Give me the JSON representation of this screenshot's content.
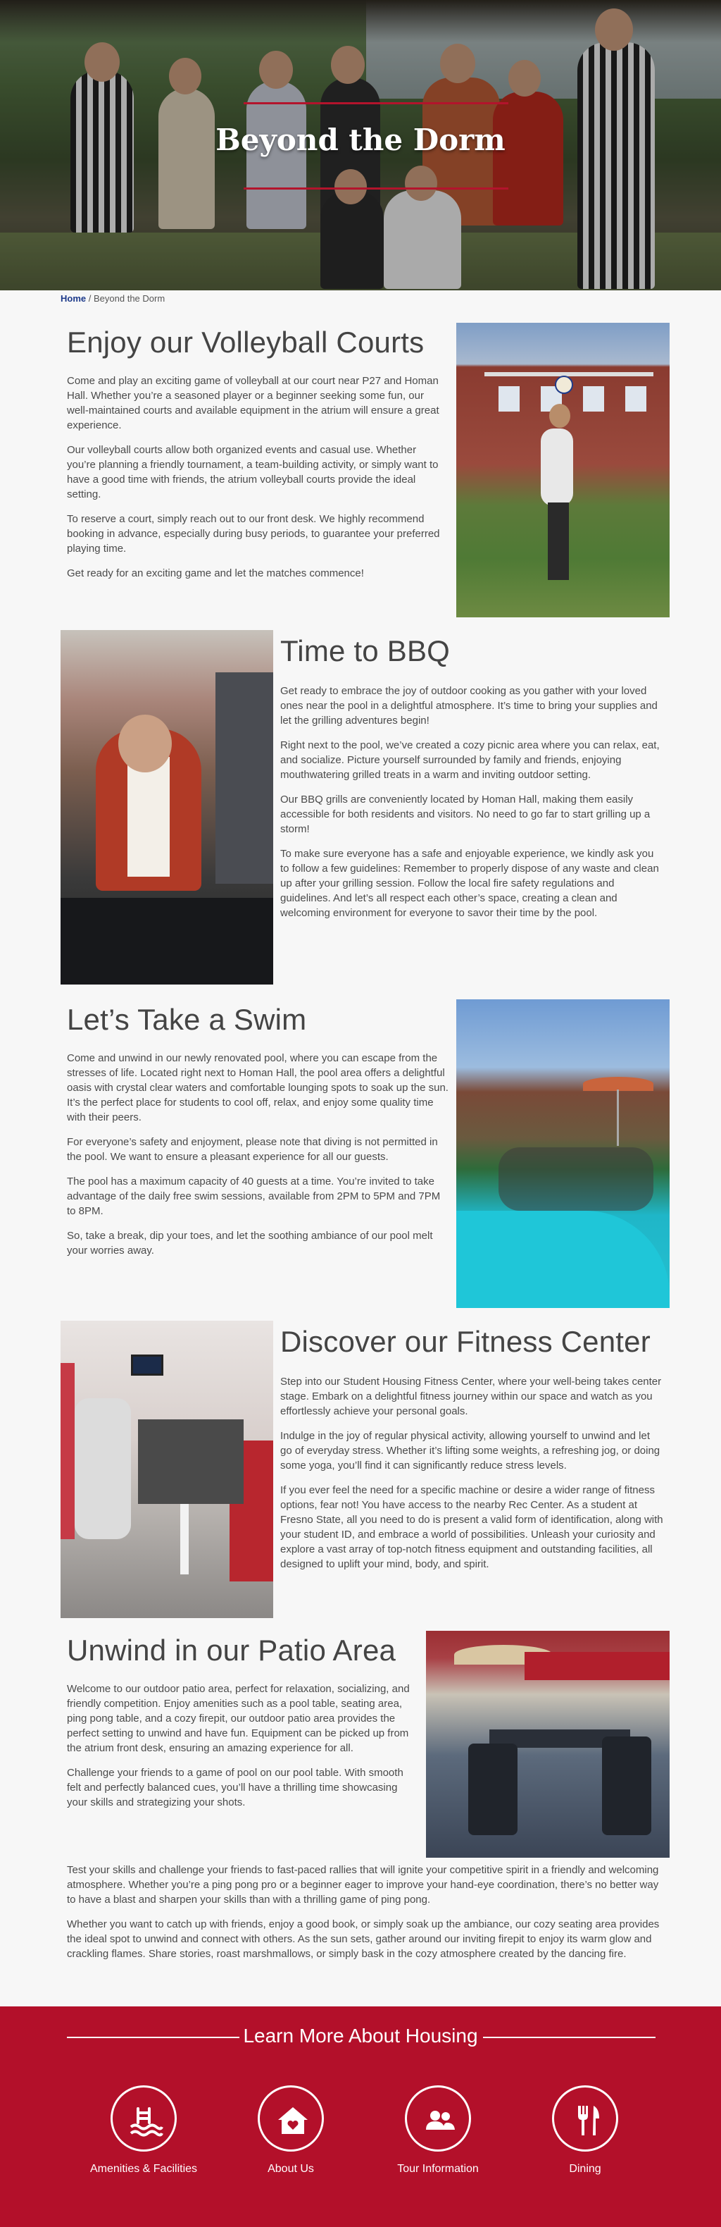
{
  "hero": {
    "title": "Beyond the Dorm"
  },
  "breadcrumb": {
    "home": "Home",
    "separator": "/",
    "current": "Beyond the Dorm"
  },
  "sections": {
    "volleyball": {
      "title": "Enjoy our Volleyball Courts",
      "paragraphs": [
        "Come and play an exciting game of volleyball at our court near P27 and Homan Hall. Whether you’re a seasoned player or a beginner seeking some fun, our well-maintained courts and available equipment in the atrium will ensure a great experience.",
        "Our volleyball courts allow both organized events and casual use. Whether you’re planning a friendly tournament, a team-building activity, or simply want to have a good time with friends, the atrium volleyball courts provide the ideal setting.",
        "To reserve a court, simply reach out to our front desk. We highly recommend booking in advance, especially during busy periods, to guarantee your preferred playing time.",
        "Get ready for an exciting game and let the matches commence!"
      ]
    },
    "bbq": {
      "title": "Time to BBQ",
      "paragraphs": [
        "Get ready to embrace the joy of outdoor cooking as you gather with your loved ones near the pool in a delightful atmosphere. It’s time to bring your supplies and let the grilling adventures begin!",
        "Right next to the pool, we’ve created a cozy picnic area where you can relax, eat, and socialize. Picture yourself surrounded by family and friends, enjoying mouthwatering grilled treats in a warm and inviting outdoor setting.",
        "Our BBQ grills are conveniently located by Homan Hall, making them easily accessible for both residents and visitors. No need to go far to start grilling up a storm!",
        "To make sure everyone has a safe and enjoyable experience, we kindly ask you to follow a few guidelines: Remember to properly dispose of any waste and clean up after your grilling session. Follow the local fire safety regulations and guidelines. And let’s all respect each other’s space, creating a clean and welcoming environment for everyone to savor their time by the pool."
      ]
    },
    "swim": {
      "title": "Let’s Take a Swim",
      "paragraphs": [
        "Come and unwind in our newly renovated pool, where you can escape from the stresses of life. Located right next to Homan Hall, the pool area offers a delightful oasis with crystal clear waters and comfortable lounging spots to soak up the sun. It’s the perfect place for students to cool off, relax, and enjoy some quality time with their peers.",
        "For everyone’s safety and enjoyment, please note that diving is not permitted in the pool. We want to ensure a pleasant experience for all our guests.",
        "The pool has a maximum capacity of 40 guests at a time. You’re invited to take advantage of the daily free swim sessions, available from 2PM to 5PM and 7PM to 8PM.",
        "So, take a break, dip your toes, and let the soothing ambiance of our pool melt your worries away."
      ]
    },
    "fitness": {
      "title": "Discover our Fitness Center",
      "paragraphs": [
        "Step into our Student Housing Fitness Center, where your well-being takes center stage. Embark on a delightful fitness journey within our space and watch as you effortlessly achieve your personal goals.",
        "Indulge in the joy of regular physical activity, allowing yourself to unwind and let go of everyday stress. Whether it’s lifting some weights, a refreshing jog, or doing some yoga, you’ll find it can significantly reduce stress levels.",
        "If you ever feel the need for a specific machine or desire a wider range of fitness options, fear not! You have access to the nearby Rec Center. As a student at Fresno State, all you need to do is present a valid form of identification, along with your student ID, and embrace a world of possibilities. Unleash your curiosity and explore a vast array of top-notch fitness equipment and outstanding facilities, all designed to uplift your mind, body, and spirit."
      ]
    },
    "patio": {
      "title": "Unwind in our Patio Area",
      "paragraphs": [
        "Welcome to our outdoor patio area, perfect for relaxation, socializing, and friendly competition. Enjoy amenities such as a pool table, seating area, ping pong table, and a cozy firepit, our outdoor patio area provides the perfect setting to unwind and have fun. Equipment can be picked up from the atrium front desk, ensuring an amazing experience for all.",
        "Challenge your friends to a game of pool on our pool table. With smooth felt and perfectly balanced cues, you’ll have a thrilling time showcasing your skills and strategizing your shots."
      ],
      "full_paragraphs": [
        "Test your skills and challenge your friends to fast-paced rallies that will ignite your competitive spirit in a friendly and welcoming atmosphere. Whether you’re a ping pong pro or a beginner eager to improve your hand-eye coordination, there’s no better way to have a blast and sharpen your skills than with a thrilling game of ping pong.",
        "Whether you want to catch up with friends, enjoy a good book, or simply soak up the ambiance, our cozy seating area provides the ideal spot to unwind and connect with others. As the sun sets, gather around our inviting firepit to enjoy its warm glow and crackling flames. Share stories, roast marshmallows, or simply bask in the cozy atmosphere created by the dancing fire."
      ]
    }
  },
  "footer": {
    "heading": "Learn More About Housing",
    "links": [
      {
        "label": "Amenities & Facilities",
        "icon": "pool-ladder-icon"
      },
      {
        "label": "About Us",
        "icon": "house-heart-icon"
      },
      {
        "label": "Tour Information",
        "icon": "people-icon"
      },
      {
        "label": "Dining",
        "icon": "utensils-icon"
      }
    ]
  },
  "colors": {
    "accent": "#b3102a",
    "link": "#1d3a8a"
  }
}
